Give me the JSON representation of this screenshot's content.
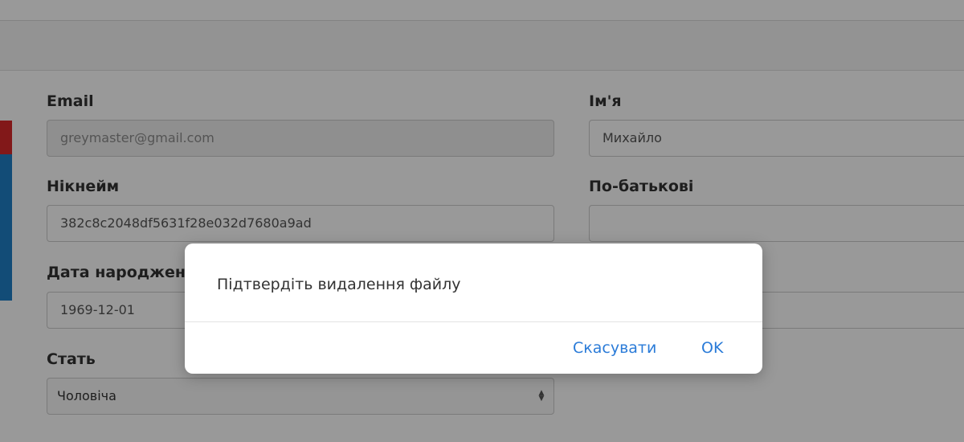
{
  "form": {
    "email": {
      "label": "Email",
      "value": "greymaster@gmail.com"
    },
    "first_name": {
      "label": "Ім'я",
      "value": "Михайло"
    },
    "nickname": {
      "label": "Нікнейм",
      "value": "382c8c2048df5631f28e032d7680a9ad"
    },
    "patronymic": {
      "label": "По-батькові",
      "value": ""
    },
    "birth_date": {
      "label": "Дата народжен",
      "value": "1969-12-01"
    },
    "gender": {
      "label": "Стать",
      "selected": "Чоловіча"
    }
  },
  "dialog": {
    "message": "Підтвердіть видалення файлу",
    "cancel_label": "Скасувати",
    "ok_label": "OK"
  },
  "colors": {
    "accent_blue": "#1f7fc7",
    "accent_red": "#d9292b",
    "dialog_button": "#2a7bd8"
  }
}
